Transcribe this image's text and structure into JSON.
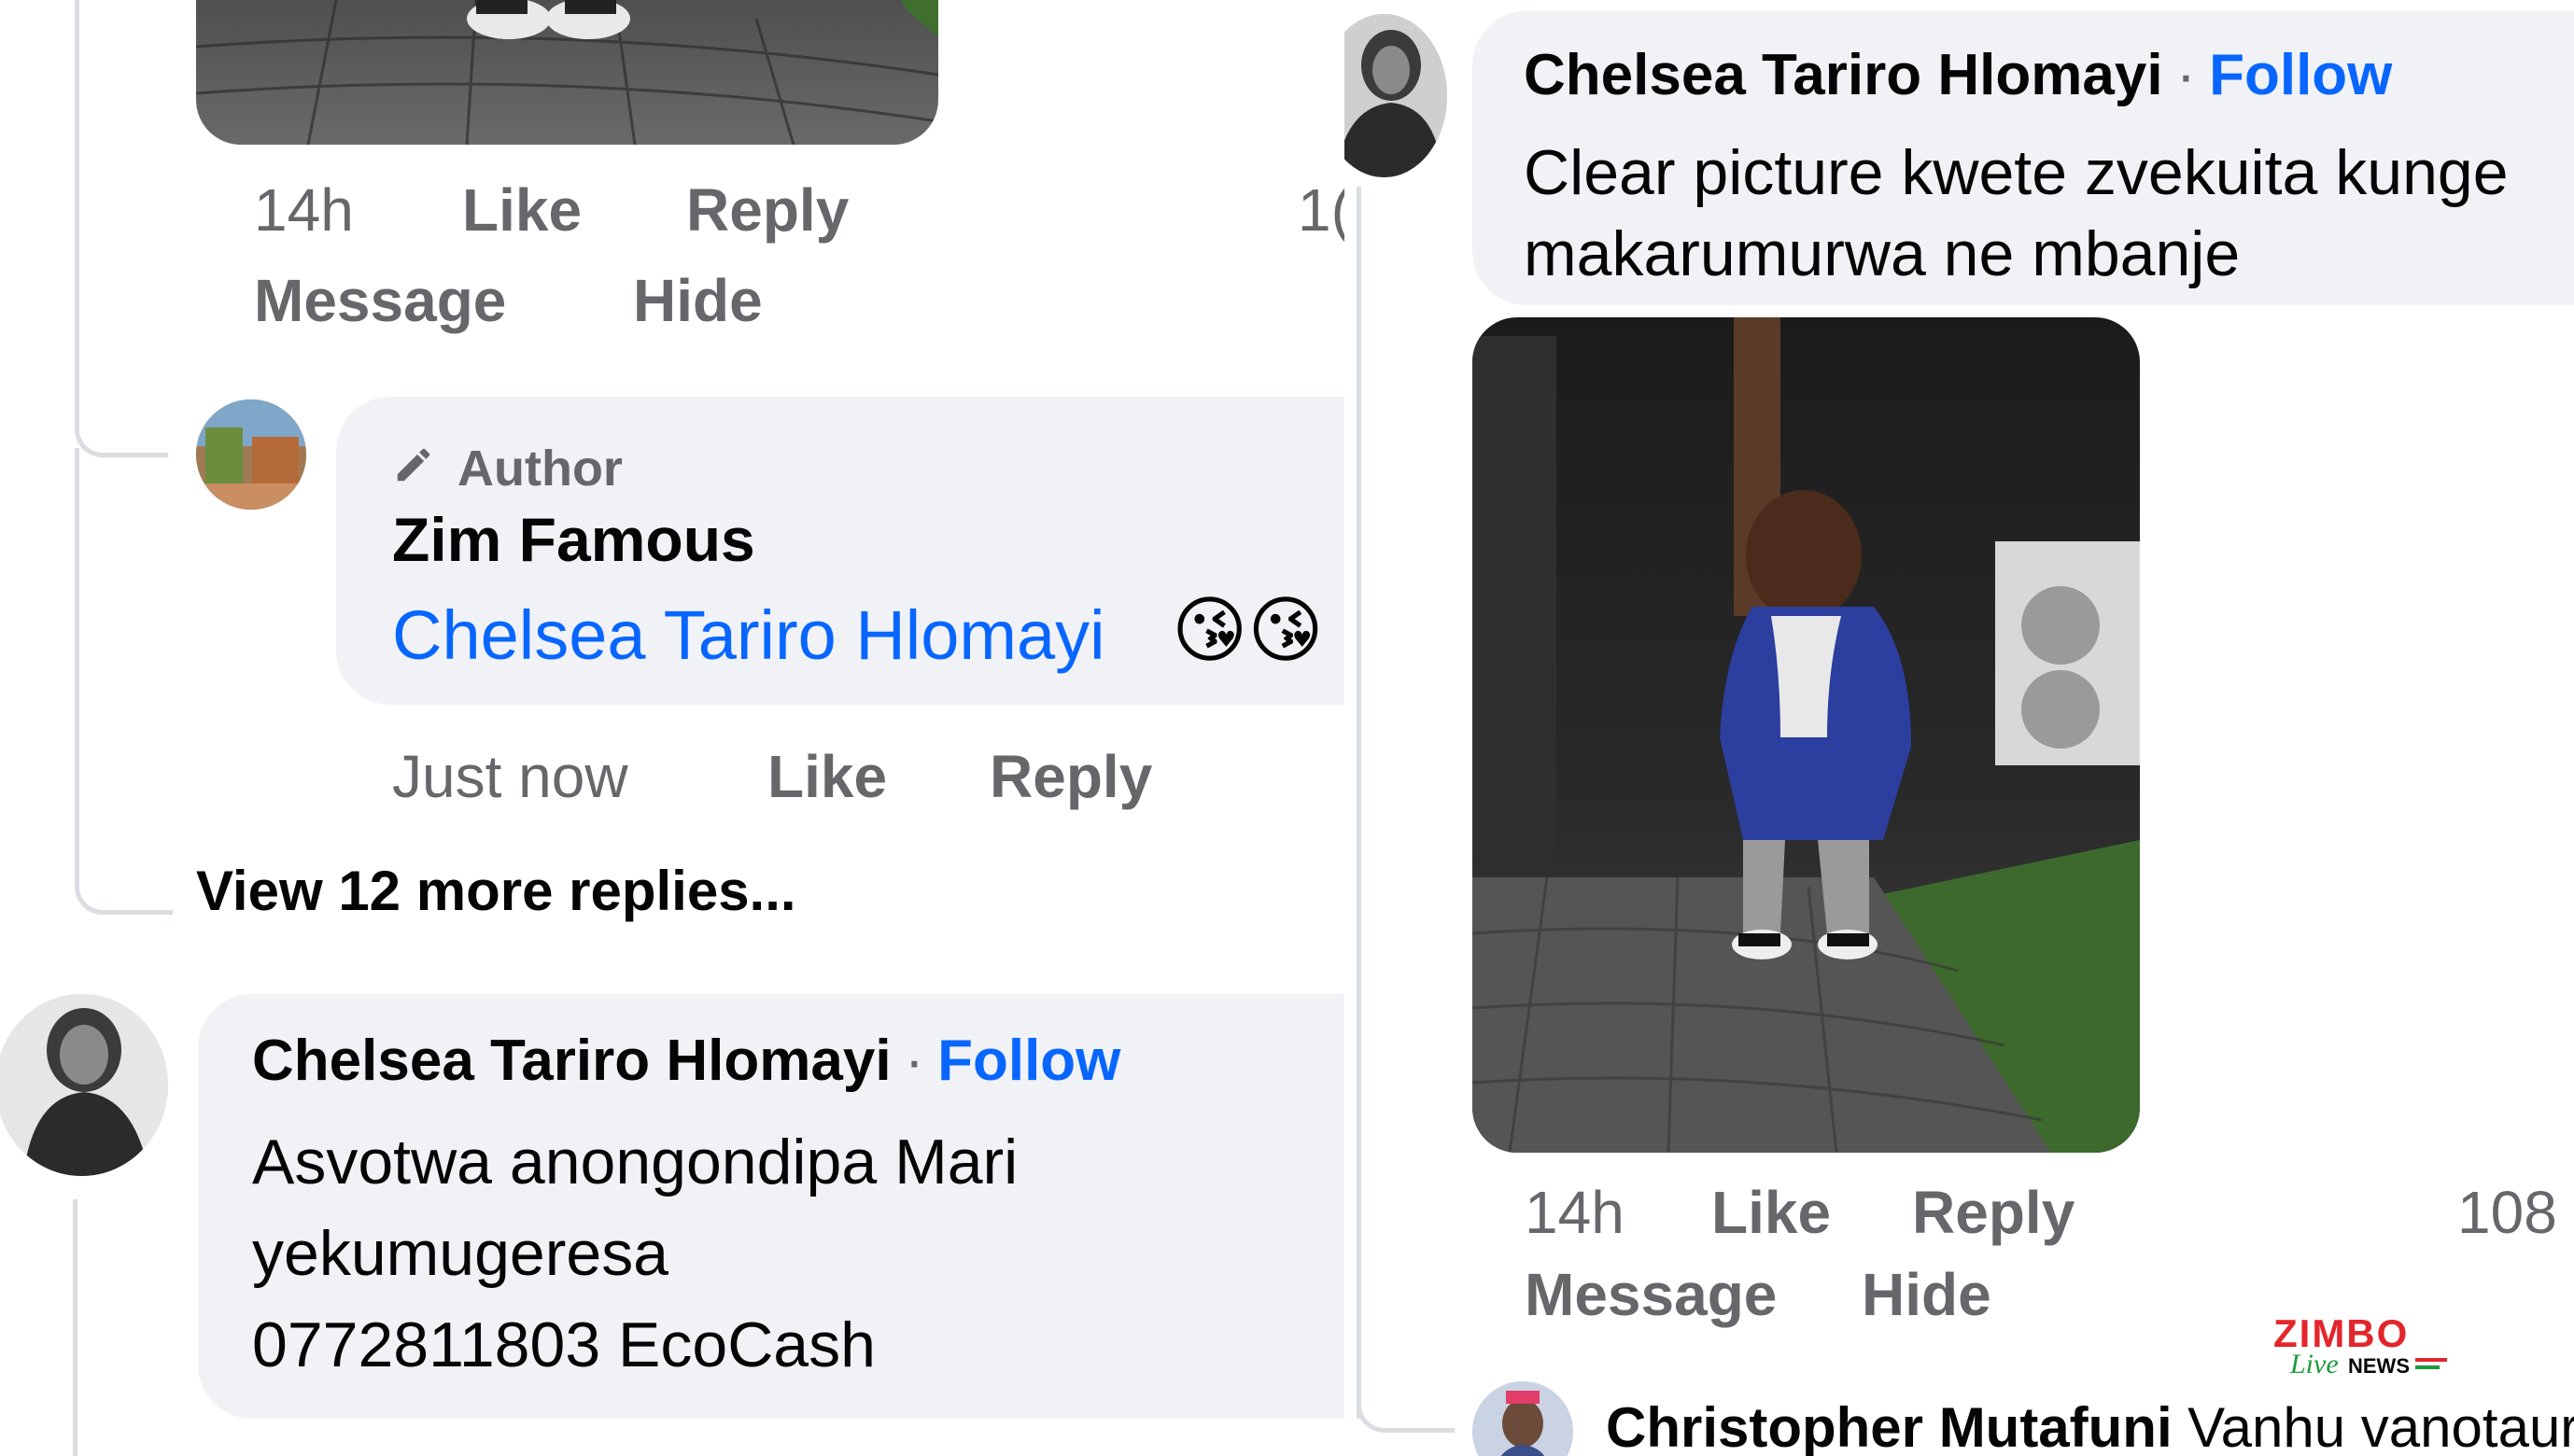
{
  "left": {
    "top_comment_actions": {
      "time": "14h",
      "like": "Like",
      "reply": "Reply",
      "count_partial": "1(",
      "message": "Message",
      "hide": "Hide"
    },
    "author_reply": {
      "badge": "Author",
      "name": "Zim Famous",
      "mention": "Chelsea Tariro Hlomayi",
      "emoji": "😘😘",
      "time": "Just now",
      "like": "Like",
      "reply": "Reply"
    },
    "view_more": "View 12 more replies...",
    "comment2": {
      "name": "Chelsea Tariro Hlomayi",
      "separator": "·",
      "follow": "Follow",
      "line1": "Asvotwa anongondipa Mari",
      "line2": "yekumugeresa",
      "line3": "0772811803 EcoCash"
    }
  },
  "right": {
    "comment": {
      "name": "Chelsea Tariro Hlomayi",
      "separator": "·",
      "follow": "Follow",
      "line1": "Clear picture kwete zvekuita kunge",
      "line2": "makarumurwa ne mbanje"
    },
    "actions": {
      "time": "14h",
      "like": "Like",
      "reply": "Reply",
      "count": "108",
      "message": "Message",
      "hide": "Hide"
    },
    "next_comment": {
      "name": "Christopher Mutafuni",
      "text": "Vanhu vanotaura"
    },
    "watermark": {
      "brand": "ZIMBO",
      "live": "Live",
      "news": "NEWS"
    }
  },
  "colors": {
    "link": "#0866ff",
    "bubble": "#f0f2f5",
    "meta": "#65676b",
    "thread": "#dadde1",
    "brand_red": "#e3262b",
    "brand_green": "#1a9a3b"
  },
  "icons": {
    "author_badge": "pencil-icon"
  }
}
